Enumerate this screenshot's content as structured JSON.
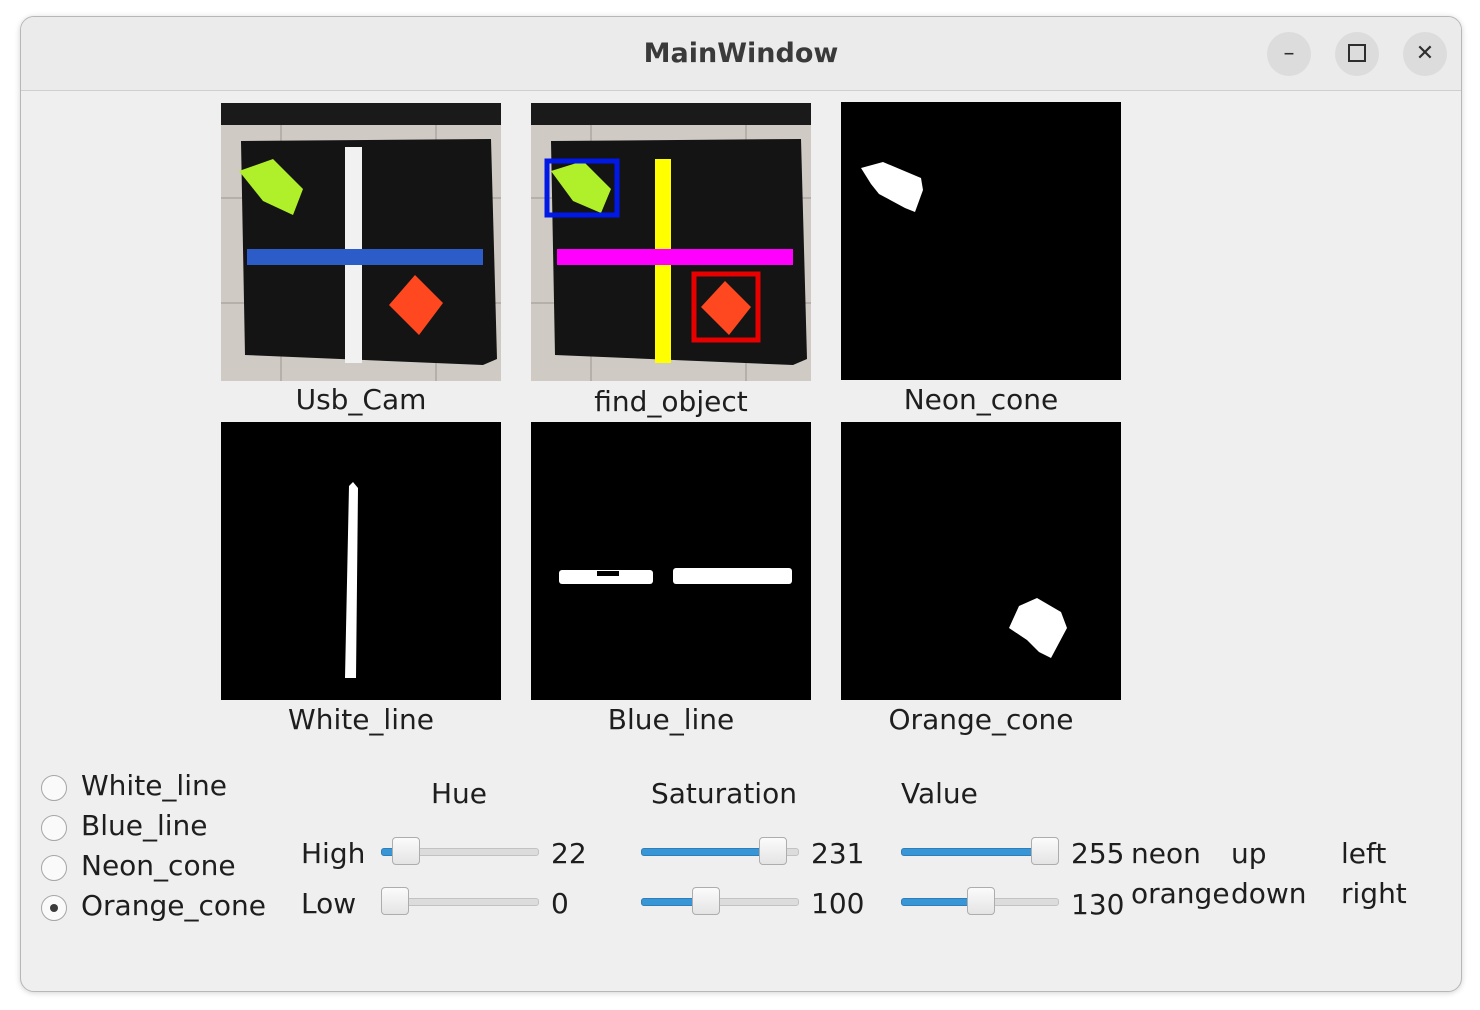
{
  "window": {
    "title": "MainWindow",
    "minimize_icon": "minimize-icon",
    "maximize_icon": "maximize-icon",
    "close_icon": "close-icon"
  },
  "images": {
    "usb_cam": "Usb_Cam",
    "find_object": "find_object",
    "neon_cone": "Neon_cone",
    "white_line": "White_line",
    "blue_line": "Blue_line",
    "orange_cone": "Orange_cone"
  },
  "radios": [
    {
      "label": "White_line",
      "checked": false
    },
    {
      "label": "Blue_line",
      "checked": false
    },
    {
      "label": "Neon_cone",
      "checked": false
    },
    {
      "label": "Orange_cone",
      "checked": true
    }
  ],
  "hsv": {
    "hue_label": "Hue",
    "saturation_label": "Saturation",
    "value_label": "Value",
    "high_label": "High",
    "low_label": "Low",
    "hue_high": "22",
    "hue_low": "0",
    "sat_high": "231",
    "sat_low": "100",
    "val_high": "255",
    "val_low": "130",
    "max": 255
  },
  "status": {
    "line1_col1": "neon",
    "line2_col1": "orange",
    "line1_col2": "up",
    "line2_col2": "down",
    "line1_col3": "left",
    "line2_col3": "right"
  },
  "colors": {
    "slider_fill": "#3996d6",
    "neon_box": "#0019e6",
    "orange_box": "#e60000",
    "white_line_detect": "#ffff00",
    "blue_line_detect": "#ff00ff"
  }
}
